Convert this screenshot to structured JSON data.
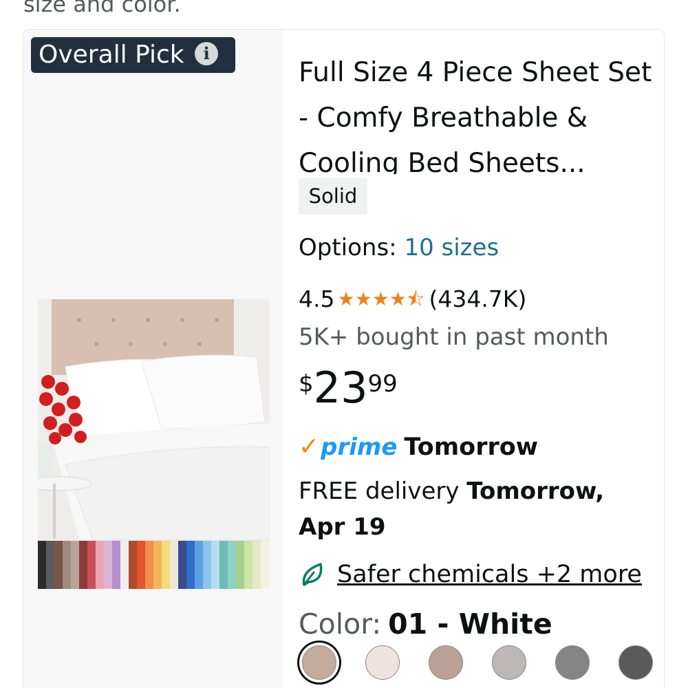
{
  "top_text": "size and color.",
  "badge": {
    "label": "Overall Pick",
    "info_icon": "i"
  },
  "product": {
    "title": "Full Size 4 Piece Sheet Set - Comfy Breathable & Cooling Bed Sheets...",
    "tag": "Solid",
    "options_label": "Options:",
    "options_value": "10 sizes",
    "rating_value": "4.5",
    "rating_stars": 4.5,
    "rating_count": "(434.7K)",
    "bought": "5K+ bought in past month",
    "price": {
      "symbol": "$",
      "whole": "23",
      "fraction": "99"
    },
    "prime_word": "prime",
    "prime_when": "Tomorrow",
    "delivery_prefix": "FREE delivery",
    "delivery_date": "Tomorrow, Apr 19",
    "safer_label": "Safer chemicals +2 more",
    "color_label": "Color:",
    "color_value": "01 - White",
    "swatches": [
      "#c4ab9b",
      "#efe3e0",
      "#b9a198",
      "#bdb7b6",
      "#858585",
      "#5a5a5a"
    ]
  },
  "colors": {
    "accent_link": "#1f6f8b",
    "star": "#f0821a",
    "prime_blue": "#1a98ff",
    "badge_bg": "#232f3e"
  }
}
